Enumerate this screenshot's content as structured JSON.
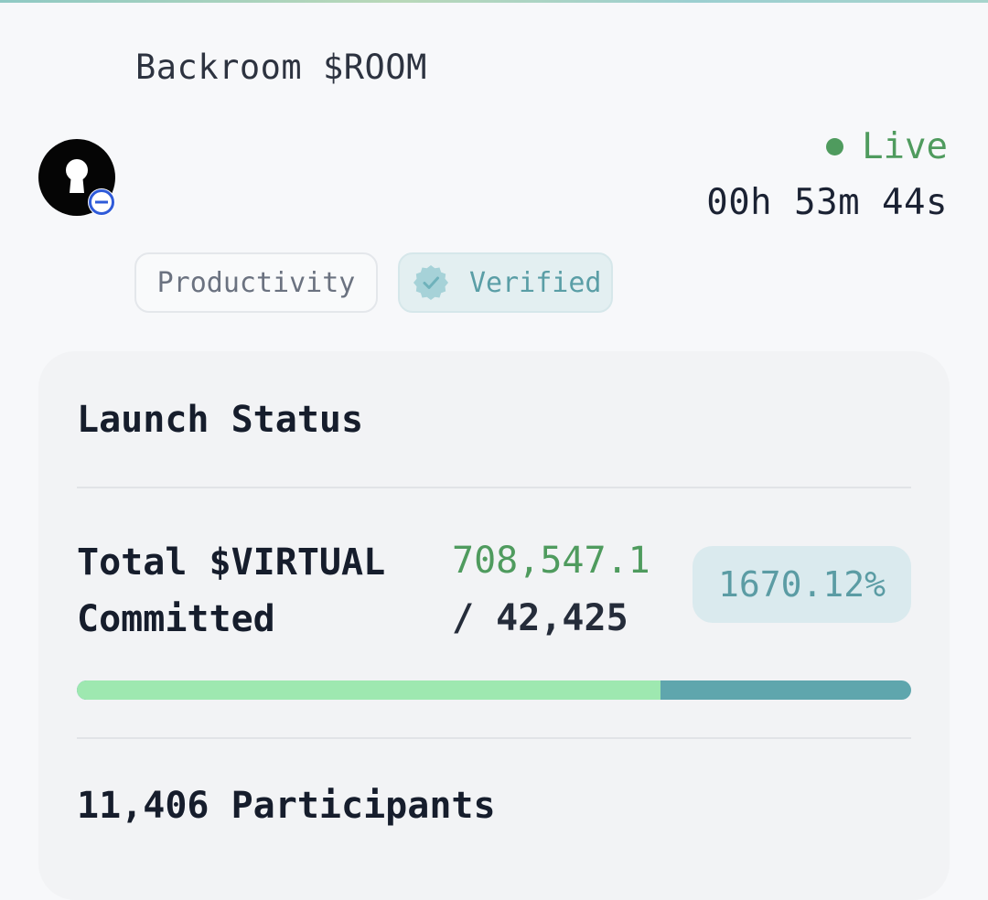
{
  "header": {
    "title": "Backroom $ROOM",
    "avatar_icon": "keyhole-icon",
    "chain_badge_icon": "base-chain-icon",
    "status_label": "Live",
    "status_color": "#4f9b5e",
    "countdown": "00h 53m 44s"
  },
  "tags": [
    {
      "label": "Productivity"
    },
    {
      "label": "Verified",
      "icon": "verified-badge-icon",
      "color": "#5a9ea6"
    }
  ],
  "launch_status": {
    "title": "Launch Status",
    "committed_label_line1": "Total $VIRTUAL",
    "committed_label_line2": "Committed",
    "committed_amount": "708,547.1",
    "committed_target": "/ 42,425",
    "percent": "1670.12%",
    "progress_fill_fraction": 0.7,
    "participants": "11,406 Participants"
  },
  "colors": {
    "accent_green": "#4f9b5e",
    "accent_teal": "#5b9ca4",
    "progress_fill": "#9ee8b0",
    "progress_track": "#5fa6ad"
  }
}
